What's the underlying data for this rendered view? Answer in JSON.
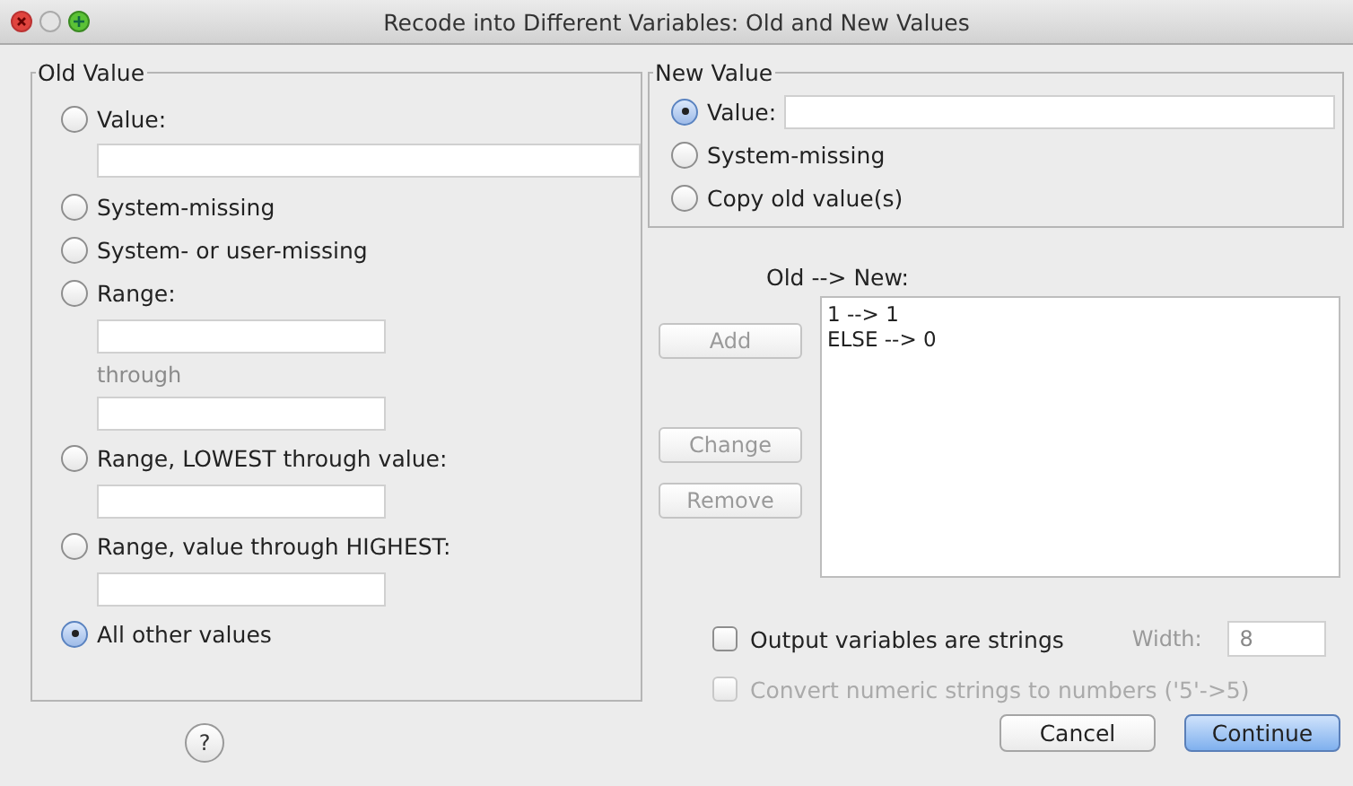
{
  "window": {
    "title": "Recode into Different Variables: Old and New Values"
  },
  "old_value": {
    "legend": "Old Value",
    "items": [
      {
        "kind": "radio",
        "label": "Value:",
        "selected": false
      },
      {
        "kind": "wide_field"
      },
      {
        "kind": "radio",
        "label": "System-missing",
        "selected": false
      },
      {
        "kind": "radio",
        "label": "System- or user-missing",
        "selected": false
      },
      {
        "kind": "radio",
        "label": "Range:",
        "selected": false
      },
      {
        "kind": "field"
      },
      {
        "kind": "caption",
        "text": "through"
      },
      {
        "kind": "field"
      },
      {
        "kind": "radio",
        "label": "Range, LOWEST through value:",
        "selected": false
      },
      {
        "kind": "field"
      },
      {
        "kind": "radio",
        "label": "Range, value through HIGHEST:",
        "selected": false
      },
      {
        "kind": "field"
      },
      {
        "kind": "radio",
        "label": "All other values",
        "selected": true
      }
    ]
  },
  "new_value": {
    "legend": "New Value",
    "options": [
      {
        "kind": "radio_field",
        "label": "Value:",
        "selected": true
      },
      {
        "kind": "radio",
        "label": "System-missing",
        "selected": false
      },
      {
        "kind": "radio",
        "label": "Copy old value(s)",
        "selected": false
      }
    ]
  },
  "list": {
    "label": "Old --> New:",
    "rows": [
      "1 --> 1",
      "ELSE --> 0"
    ]
  },
  "list_buttons": [
    {
      "label": "Add",
      "disabled": true
    },
    {
      "label": "Change",
      "disabled": true
    },
    {
      "label": "Remove",
      "disabled": true
    }
  ],
  "options": [
    {
      "label": "Output variables are strings",
      "checked": false,
      "disabled": false
    },
    {
      "label": "Convert numeric strings to numbers ('5'->5)",
      "checked": false,
      "disabled": true
    }
  ],
  "width": {
    "label": "Width:",
    "value": "8",
    "disabled": true
  },
  "help": {
    "label": "?"
  },
  "buttons": [
    {
      "label": "Cancel",
      "default": false
    },
    {
      "label": "Continue",
      "default": true
    }
  ]
}
